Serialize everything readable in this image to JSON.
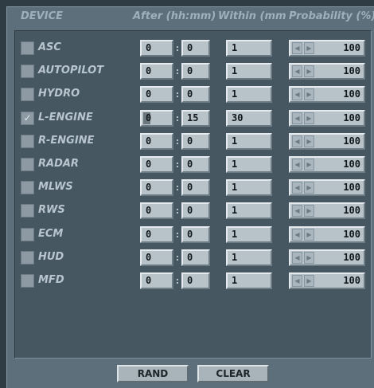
{
  "header": {
    "device": "DEVICE",
    "after": "After (hh:mm)",
    "within": "Within (mm",
    "probability": "Probability (%)"
  },
  "colon": ":",
  "rows": [
    {
      "name": "ASC",
      "checked": false,
      "hh": "0",
      "mm": "0",
      "within": "1",
      "prob": "100"
    },
    {
      "name": "AUTOPILOT",
      "checked": false,
      "hh": "0",
      "mm": "0",
      "within": "1",
      "prob": "100"
    },
    {
      "name": "HYDRO",
      "checked": false,
      "hh": "0",
      "mm": "0",
      "within": "1",
      "prob": "100"
    },
    {
      "name": "L-ENGINE",
      "checked": true,
      "hh": "0",
      "mm": "15",
      "within": "30",
      "prob": "100"
    },
    {
      "name": "R-ENGINE",
      "checked": false,
      "hh": "0",
      "mm": "0",
      "within": "1",
      "prob": "100"
    },
    {
      "name": "RADAR",
      "checked": false,
      "hh": "0",
      "mm": "0",
      "within": "1",
      "prob": "100"
    },
    {
      "name": "MLWS",
      "checked": false,
      "hh": "0",
      "mm": "0",
      "within": "1",
      "prob": "100"
    },
    {
      "name": "RWS",
      "checked": false,
      "hh": "0",
      "mm": "0",
      "within": "1",
      "prob": "100"
    },
    {
      "name": "ECM",
      "checked": false,
      "hh": "0",
      "mm": "0",
      "within": "1",
      "prob": "100"
    },
    {
      "name": "HUD",
      "checked": false,
      "hh": "0",
      "mm": "0",
      "within": "1",
      "prob": "100"
    },
    {
      "name": "MFD",
      "checked": false,
      "hh": "0",
      "mm": "0",
      "within": "1",
      "prob": "100"
    }
  ],
  "buttons": {
    "rand": "RAND",
    "clear": "CLEAR"
  },
  "icons": {
    "check": "✓",
    "left": "◀",
    "right": "▶"
  }
}
